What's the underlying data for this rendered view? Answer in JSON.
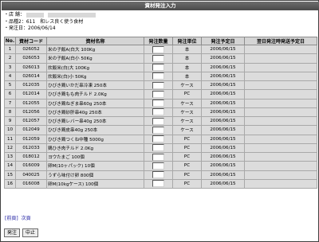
{
  "window": {
    "title": "資材発注入力"
  },
  "info": {
    "store_label": "・店 舗：",
    "store_value": "",
    "category_label": "・品種2：",
    "category_value": "611　和レス良く使う食材",
    "order_date_label": "・発注日：",
    "order_date_value": "2006/06/14"
  },
  "table": {
    "headers": [
      "No.",
      "資材コード",
      "資材名称",
      "発注数量",
      "発注単位",
      "発注予定日",
      "翌日発注時発送予定日"
    ],
    "rows": [
      {
        "no": "1",
        "code": "026052",
        "name": "米の子飯A(白大 100Kg",
        "unit": "本",
        "date": "2006/06/15"
      },
      {
        "no": "2",
        "code": "026053",
        "name": "米の子飯A(白小 50Kg",
        "unit": "本",
        "date": "2006/06/15"
      },
      {
        "no": "3",
        "code": "026013",
        "name": "炊飯米(白)大 100Kg",
        "unit": "本",
        "date": "2006/06/15"
      },
      {
        "no": "4",
        "code": "026014",
        "name": "炊飯米(白)小 50Kg",
        "unit": "本",
        "date": "2006/06/15"
      },
      {
        "no": "5",
        "code": "012035",
        "name": "ひびき鶏いかだ串冷凍 250本",
        "unit": "ケース",
        "date": "2006/06/15"
      },
      {
        "no": "6",
        "code": "012014",
        "name": "ひびき鶏もも肉チルド 2.0Kg",
        "unit": "PC",
        "date": "2006/06/15"
      },
      {
        "no": "7",
        "code": "012055",
        "name": "ひびき鶏ねぎま串60g 250本",
        "unit": "ケース",
        "date": "2006/06/15"
      },
      {
        "no": "8",
        "code": "012056",
        "name": "ひびき鶏砂肝串40g 250本",
        "unit": "ケース",
        "date": "2006/06/15"
      },
      {
        "no": "9",
        "code": "012057",
        "name": "ひびき鶏レバー串40g 250本",
        "unit": "ケース",
        "date": "2006/06/15"
      },
      {
        "no": "10",
        "code": "012049",
        "name": "ひびき鶏皮串40g 250本",
        "unit": "ケース",
        "date": "2006/06/15"
      },
      {
        "no": "11",
        "code": "012059",
        "name": "ひびき鶏つくね中種 5000g",
        "unit": "PC",
        "date": "2006/06/15"
      },
      {
        "no": "12",
        "code": "012033",
        "name": "鶏ひき肉チルド 2.0Kg",
        "unit": "PC",
        "date": "2006/06/15"
      },
      {
        "no": "13",
        "code": "018012",
        "name": "ヨウたまご 100個",
        "unit": "PC",
        "date": "2006/06/15"
      },
      {
        "no": "14",
        "code": "016009",
        "name": "卵M(10ヶパック) 10個",
        "unit": "PC",
        "date": "2006/06/15"
      },
      {
        "no": "15",
        "code": "040025",
        "name": "うずら味付け卵 800個",
        "unit": "PC",
        "date": "2006/06/15"
      },
      {
        "no": "16",
        "code": "016008",
        "name": "卵M(10kgケース) 100個",
        "unit": "PC",
        "date": "2006/06/15"
      }
    ]
  },
  "pager": {
    "prev": "[前頁]",
    "next": "次頁"
  },
  "buttons": {
    "order": "発注",
    "cancel": "中止"
  }
}
